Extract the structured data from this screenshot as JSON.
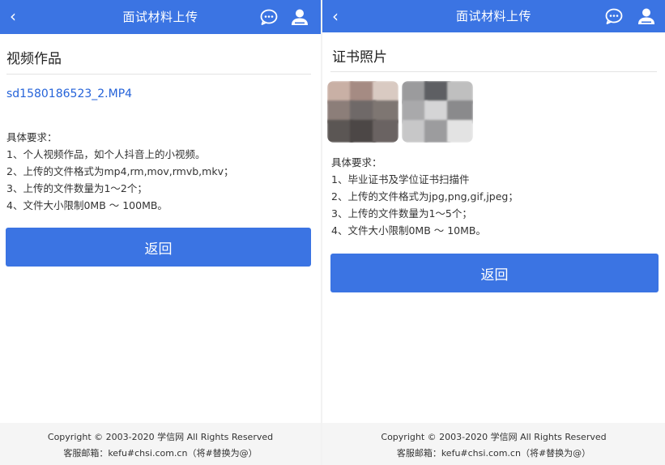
{
  "left": {
    "header": {
      "title": "面试材料上传",
      "back_glyph": "‹"
    },
    "section_title": "视频作品",
    "file_name": "sd1580186523_2.MP4",
    "requirements": [
      "具体要求：",
      "1、个人视频作品，如个人抖音上的小视频。",
      "2、上传的文件格式为mp4,rm,mov,rmvb,mkv；",
      "3、上传的文件数量为1～2个；",
      "4、文件大小限制0MB ～ 100MB。"
    ],
    "return_label": "返回",
    "footer": {
      "copyright": "Copyright © 2003-2020 学信网 All Rights Reserved",
      "email": "客服邮箱：kefu#chsi.com.cn（将#替换为@）"
    }
  },
  "right": {
    "header": {
      "title": "面试材料上传",
      "back_glyph": "‹"
    },
    "section_title": "证书照片",
    "requirements": [
      "具体要求：",
      "1、毕业证书及学位证书扫描件",
      "2、上传的文件格式为jpg,png,gif,jpeg；",
      "3、上传的文件数量为1～5个；",
      "4、文件大小限制0MB ～ 10MB。"
    ],
    "return_label": "返回",
    "footer": {
      "copyright": "Copyright © 2003-2020 学信网 All Rights Reserved",
      "email": "客服邮箱：kefu#chsi.com.cn（将#替换为@）"
    }
  },
  "icons": [
    "chat-bubble-icon",
    "user-icon"
  ],
  "colors": {
    "brand": "#3b74e3",
    "link": "#2563d9",
    "footer_bg": "#f5f5f5"
  }
}
